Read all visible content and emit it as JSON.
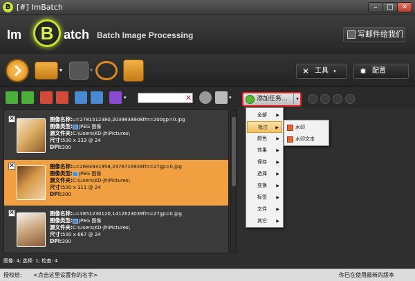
{
  "window": {
    "title": "[#] ImBatch",
    "app_icon_letter": "B"
  },
  "header": {
    "logo_im": "Im",
    "logo_b": "B",
    "logo_atch": "atch",
    "logo_subtitle": "Batch Image Processing",
    "mail_button": "写邮件给我们"
  },
  "toolbar": {
    "tools_label": "工具",
    "config_label": "配置"
  },
  "images": [
    {
      "name_label": "图像名称:",
      "name": "u=2781512380,2039838908fm=200gp=0.jpg",
      "type_label": "图像类型:",
      "type": "JPEG 图像",
      "folder_label": "源文件夹:",
      "folder": "C:\\Users\\KD-jh\\Pictures\\",
      "size_label": "尺寸:",
      "size": "500 x 333 @ 24",
      "dpi_label": "DPI:",
      "dpi": "300",
      "selected": false
    },
    {
      "name_label": "图像名称:",
      "name": "u=2693931958,2376716928fm=27gp=0.jpg",
      "type_label": "图像类型:",
      "type": "JPEG 图像",
      "folder_label": "源文件夹:",
      "folder": "C:\\Users\\KD-jh\\Pictures\\",
      "size_label": "尺寸:",
      "size": "500 x 311 @ 24",
      "dpi_label": "DPI:",
      "dpi": "300",
      "selected": true
    },
    {
      "name_label": "图像名称:",
      "name": "u=3851230120,1412623039fm=27gp=0.jpg",
      "type_label": "图像类型:",
      "type": "JPEG 图像",
      "folder_label": "源文件夹:",
      "folder": "C:\\Users\\KD-jh\\Pictures\\",
      "size_label": "尺寸:",
      "size": "500 x 667 @ 24",
      "dpi_label": "DPI:",
      "dpi": "300",
      "selected": false
    }
  ],
  "list_status": "图像: 4; 选择: 1; 检查: 4",
  "tasks": {
    "add_task_label": "添加任务..."
  },
  "menu": [
    {
      "label": "全部",
      "has_sub": true
    },
    {
      "label": "批注",
      "has_sub": true,
      "highlighted": true
    },
    {
      "label": "颜色",
      "has_sub": true
    },
    {
      "label": "效果",
      "has_sub": true
    },
    {
      "label": "保存",
      "has_sub": true
    },
    {
      "label": "选择",
      "has_sub": true
    },
    {
      "label": "变换",
      "has_sub": true
    },
    {
      "label": "标签",
      "has_sub": true
    },
    {
      "label": "文件",
      "has_sub": true
    },
    {
      "label": "其它",
      "has_sub": true
    }
  ],
  "submenu": [
    {
      "label": "水印"
    },
    {
      "label": "水印文本"
    }
  ],
  "statusbar": {
    "auth_label": "授权给:",
    "auth_value": "<点击这里设置你的名字>",
    "version_status": "你已在使用最新的版本"
  }
}
